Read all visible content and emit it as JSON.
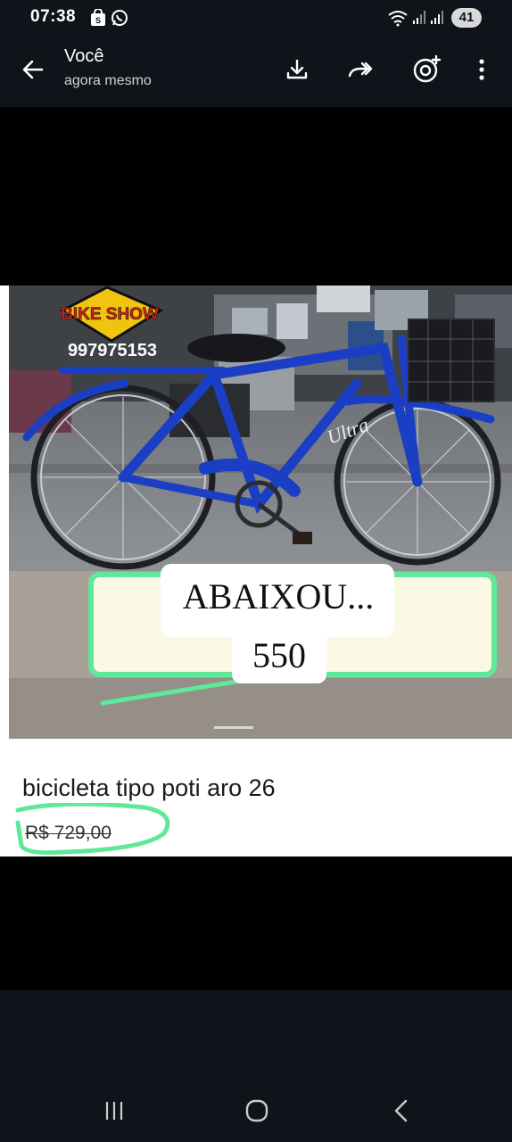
{
  "status_bar": {
    "time": "07:38",
    "battery": "41",
    "icons": [
      "shopping-bag-icon",
      "whatsapp-icon",
      "wifi-icon",
      "signal-icon",
      "signal-icon",
      "battery-icon"
    ]
  },
  "app_bar": {
    "back_icon": "arrow-left-icon",
    "title": "Você",
    "subtitle": "agora mesmo",
    "actions": [
      "download-icon",
      "forward-icon",
      "add-status-icon",
      "more-vert-icon"
    ]
  },
  "image": {
    "logo_text": "BIKE SHOW",
    "phone": "997975153",
    "promo_line1": "ABAIXOU...",
    "promo_line2": "550",
    "frame_brand": "Ultra",
    "caption": "bicicleta tipo poti aro 26",
    "price": "R$ 729,00",
    "colors": {
      "bike": "#1a3fc4",
      "highlight": "#5ee89a"
    }
  },
  "nav_bar": {
    "buttons": [
      "recent-apps-icon",
      "home-icon",
      "back-icon"
    ]
  }
}
